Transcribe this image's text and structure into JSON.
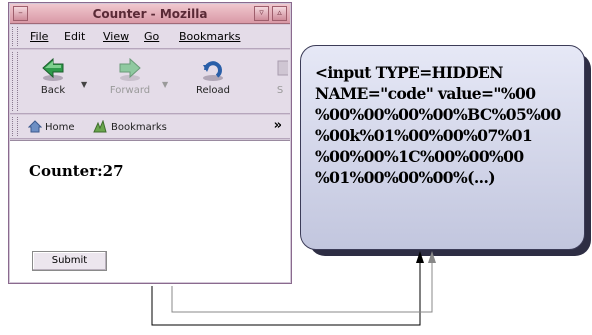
{
  "browser": {
    "title": "Counter - Mozilla",
    "menu": [
      "File",
      "Edit",
      "View",
      "Go",
      "Bookmarks"
    ],
    "nav": {
      "back": "Back",
      "forward": "Forward",
      "reload": "Reload",
      "stop_partial": "S"
    },
    "personal_toolbar": {
      "home": "Home",
      "bookmarks": "Bookmarks",
      "more": "»"
    },
    "page": {
      "counter_text": "Counter:27",
      "submit_label": "Submit"
    }
  },
  "callout": {
    "text": "<input TYPE=HIDDEN\nNAME=\"code\" value=\"%00\n%00%00%00%00%BC%05%00\n%00k%01%00%00%07%01\n%00%00%1C%00%00%00\n%01%00%00%00%(...)"
  },
  "colors": {
    "titlebar": "#d999a6",
    "window": "#d4c8d8",
    "callout_fill": "#c2c6de",
    "callout_shadow": "#2e2e44",
    "arrow_black": "#000000",
    "arrow_gray": "#888888"
  }
}
